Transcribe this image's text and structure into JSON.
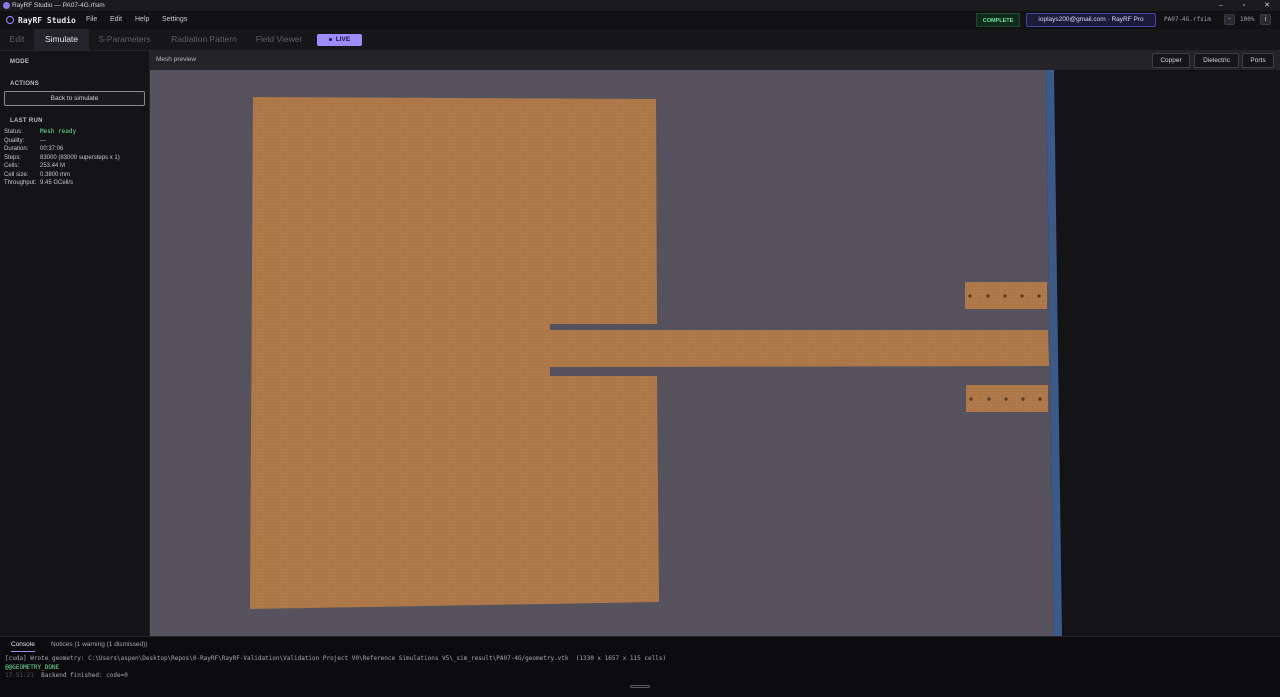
{
  "window": {
    "title": "RayRF Studio — PA07-4G.rfsim",
    "controls": {
      "minimize": "–",
      "maximize": "▫",
      "close": "✕"
    }
  },
  "menu": {
    "brand": "RayRF Studio",
    "items": [
      "File",
      "Edit",
      "Help",
      "Settings"
    ],
    "status": "COMPLETE",
    "account": "ioplays200@gmail.com · RayRF Pro",
    "file": "PA07-4G.rfsim",
    "zoom_minus": "-",
    "zoom_level": "100%",
    "zoom_info": "i"
  },
  "tabs": {
    "items": [
      "Edit",
      "Simulate",
      "S-Parameters",
      "Radiation Pattern",
      "Field Viewer"
    ],
    "active": "Simulate",
    "live": "LIVE"
  },
  "sidebar": {
    "mode_header": "MODE",
    "actions_header": "ACTIONS",
    "back_button": "Back to simulate",
    "last_run_header": "LAST RUN",
    "stats": [
      {
        "key": "Status:",
        "value": "Mesh ready"
      },
      {
        "key": "Quality:",
        "value": "—"
      },
      {
        "key": "Duration:",
        "value": "00:37:06"
      },
      {
        "key": "Steps:",
        "value": "83000 (83000 supersteps x 1)"
      },
      {
        "key": "Cells:",
        "value": "253.44 M"
      },
      {
        "key": "Cell size:",
        "value": "0.3800 mm"
      },
      {
        "key": "Throughput:",
        "value": "9.45 GCell/s"
      }
    ]
  },
  "viewport": {
    "title": "Mesh preview",
    "layer_buttons": [
      "Copper",
      "Dielectric",
      "Ports"
    ]
  },
  "console": {
    "tabs": [
      "Console",
      "Notices (1 warning (1 dismissed))"
    ],
    "lines": [
      {
        "ts": "",
        "text": "[cuda] Wrote geometry: C:\\Users\\aspen\\Desktop\\Repos\\0-RayRF\\RayRF-Validation\\Validation Project V0\\Reference Simulations V5\\_sim_result\\PA07-4G/geometry.vtk  (1330 x 1657 x 115 cells)"
      },
      {
        "ts": "",
        "text": "@@GEOMETRY_DONE"
      },
      {
        "ts": "17:51:21",
        "text": "Backend finished: code=0"
      }
    ]
  },
  "colors": {
    "accent": "#9c8cff",
    "success": "#6fe09a",
    "copper": "#b07a4a",
    "substrate": "#56535e",
    "edge": "#3a5a8a"
  }
}
